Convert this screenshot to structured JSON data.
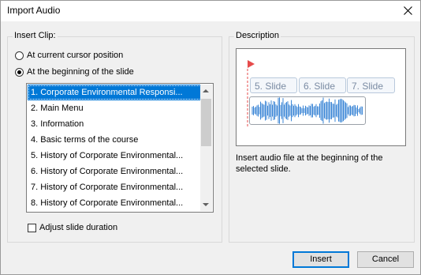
{
  "window": {
    "title": "Import Audio"
  },
  "insert_clip": {
    "label": "Insert Clip:",
    "options": [
      {
        "label": "At current cursor position",
        "checked": false
      },
      {
        "label": "At the beginning of the slide",
        "checked": true
      }
    ],
    "slides": [
      "1. Corporate Environmental Responsi...",
      "2. Main Menu",
      "3. Information",
      "4. Basic terms of the course",
      "5. History of Corporate Environmental...",
      "6. History of Corporate Environmental...",
      "7. History of Corporate Environmental...",
      "8. History of Corporate Environmental..."
    ],
    "selected_index": 0,
    "adjust_label": "Adjust slide duration",
    "adjust_checked": false
  },
  "description": {
    "label": "Description",
    "slides": [
      "5. Slide",
      "6. Slide",
      "7. Slide"
    ],
    "text": "Insert audio file at the beginning of the selected slide.",
    "colors": {
      "marker": "#e64b4b",
      "wave": "#3b86d6",
      "slide_text": "#7a8ba3"
    }
  },
  "buttons": {
    "insert": "Insert",
    "cancel": "Cancel"
  }
}
